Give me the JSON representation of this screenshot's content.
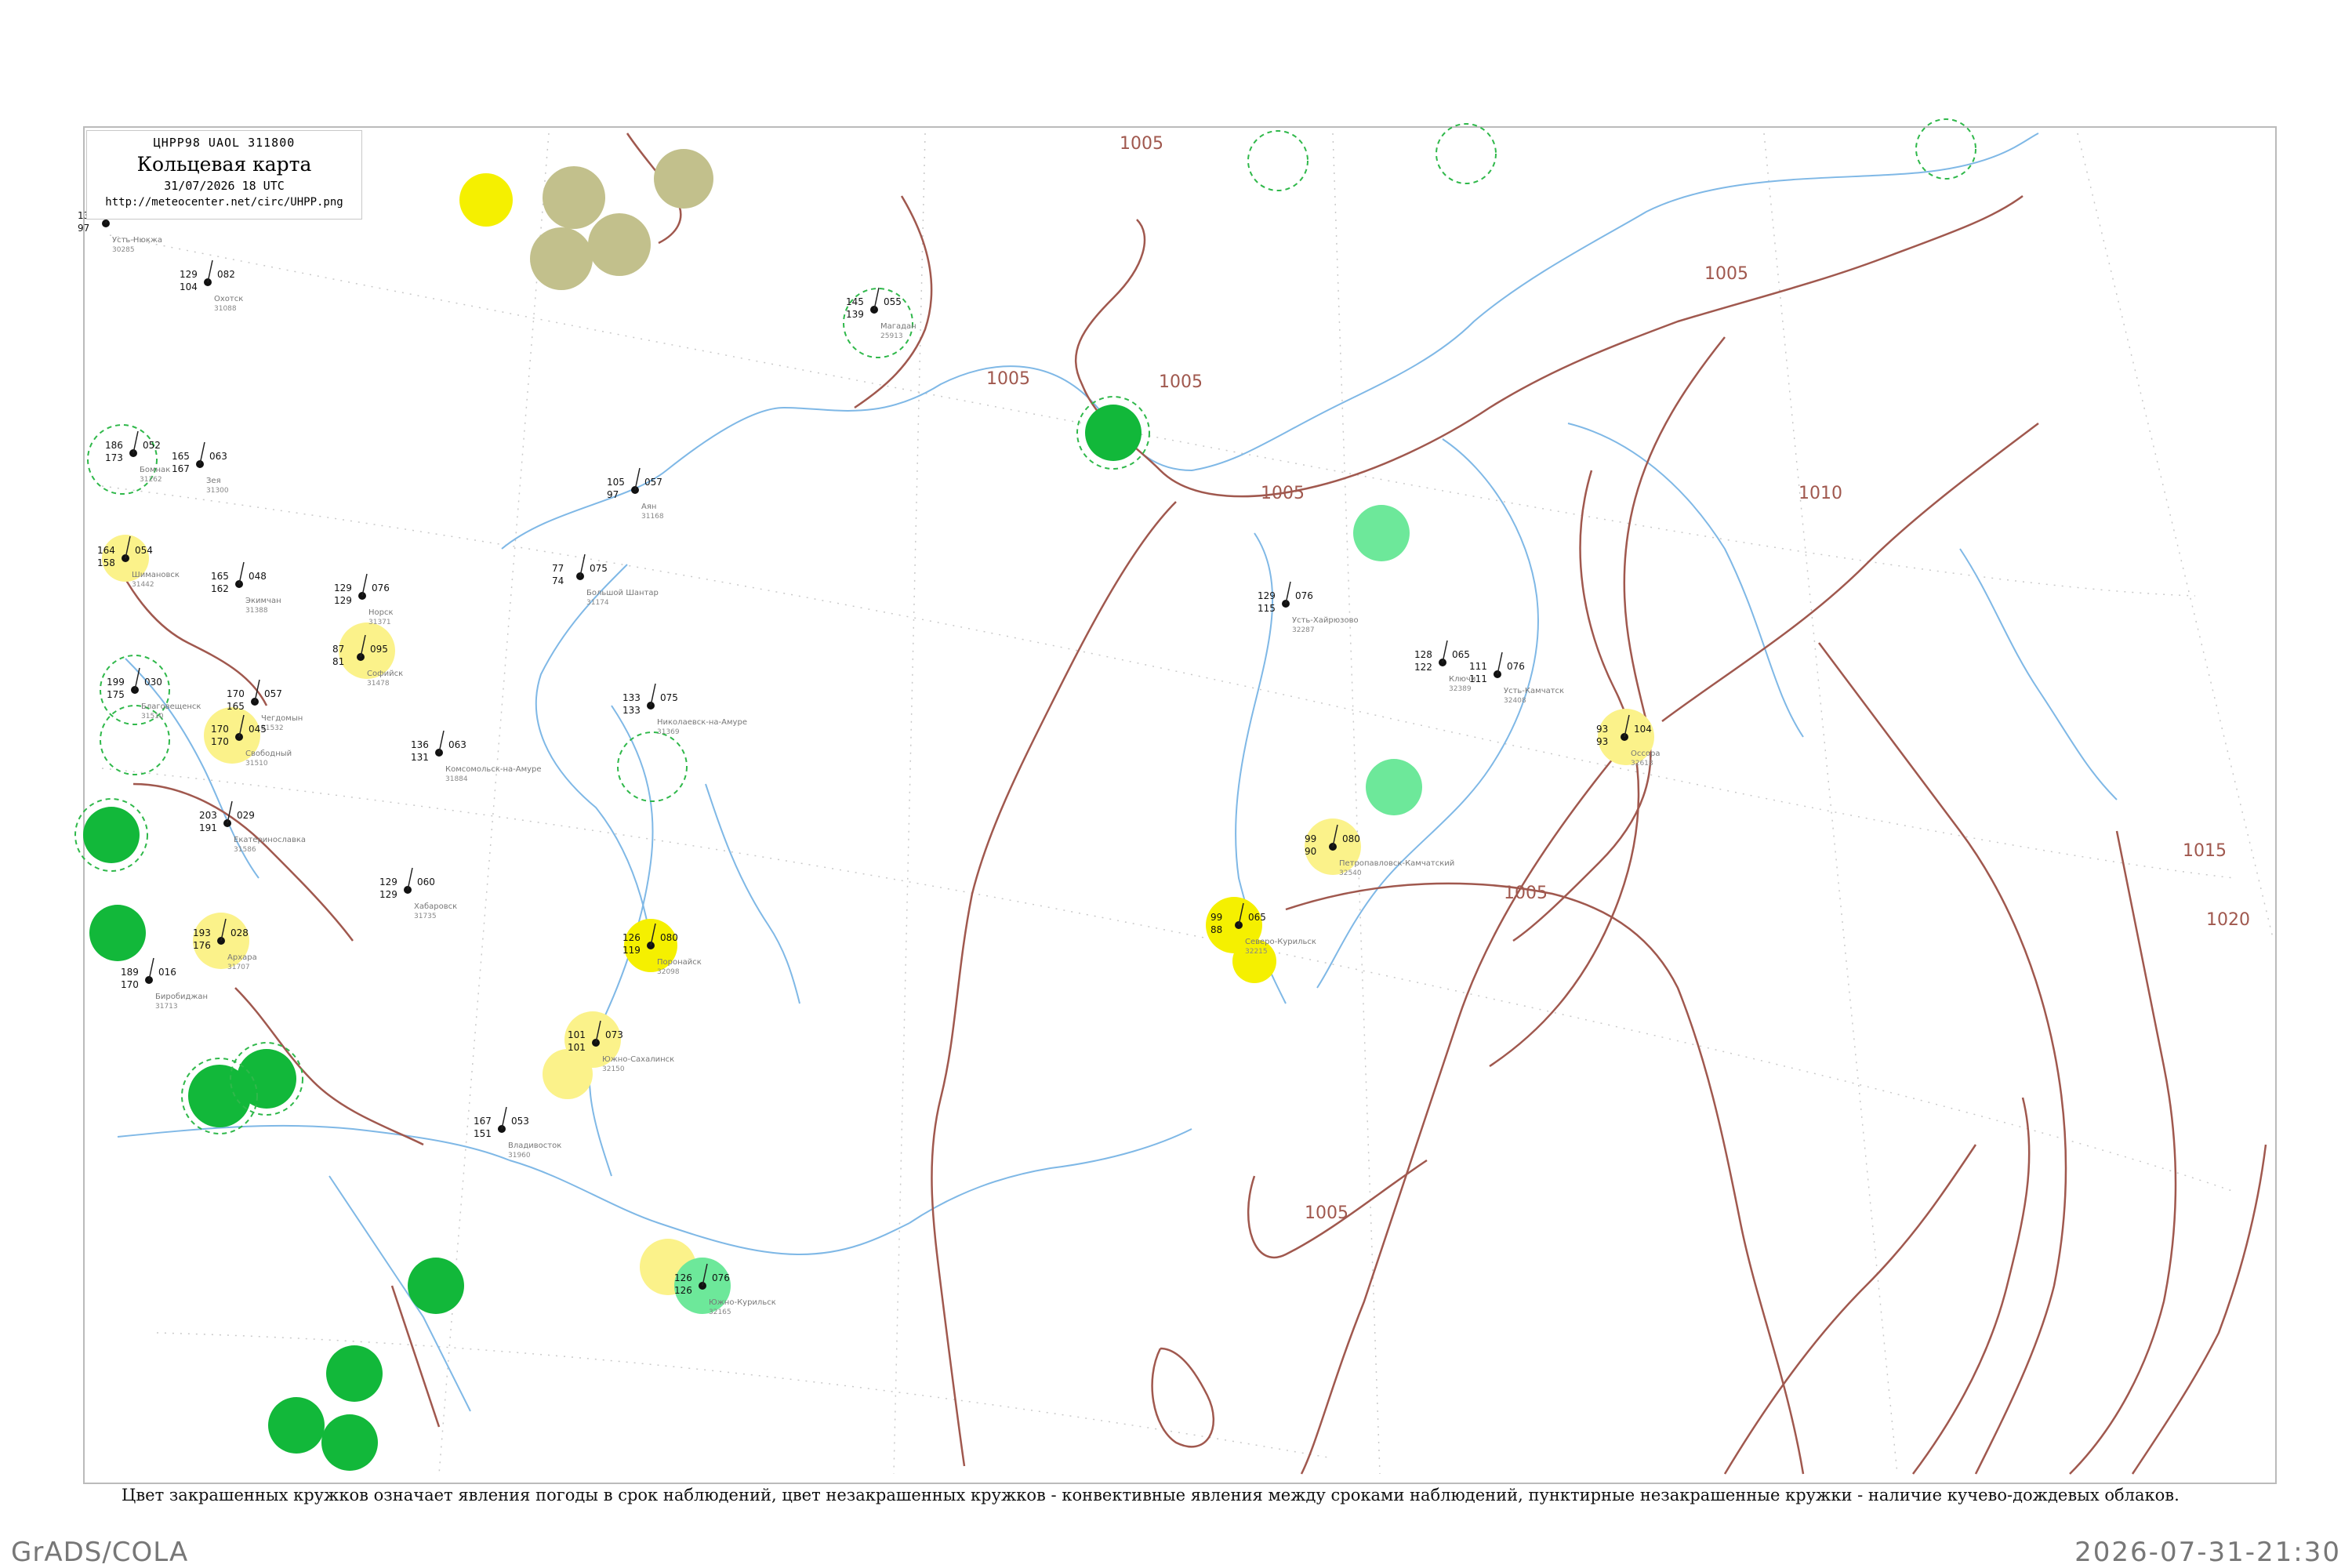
{
  "legend": {
    "code": "ЦHPP98  UAOL  311800",
    "title": "Кольцевая карта",
    "date": "31/07/2026 18 UTC",
    "url": "http://meteocenter.net/circ/UHPP.png"
  },
  "caption": "Цвет закрашенных кружков означает явления погоды в срок наблюдений, цвет незакрашенных кружков - конвективные явления между сроками наблюдений, пунктирные незакрашенные кружки - наличие кучево-дождевых облаков.",
  "footer": {
    "software": "GrADS/COLA",
    "timestamp": "2026-07-31-21:30"
  },
  "colors": {
    "isobar": "#a0584e",
    "coast": "#7fb8e6",
    "dark_green": "#12b83a",
    "green": "#6de89a",
    "yellow": "#f5f000",
    "light_yellow": "#fbf28a",
    "olive": "#c2c08c",
    "dashed_green": "#2fb84a"
  },
  "isobar_labels": [
    "1005",
    "1005",
    "1005",
    "1005",
    "1005",
    "1005",
    "1005",
    "1010",
    "1015",
    "1020"
  ],
  "stations": [
    {
      "name": "Усть-Нюкжа",
      "id": "30285",
      "p": "121",
      "t": "132",
      "td": "97"
    },
    {
      "name": "Зея",
      "id": "31300",
      "p": "063",
      "t": "165",
      "td": "167"
    },
    {
      "name": "Шимановск",
      "id": "31442",
      "p": "054",
      "t": "164",
      "td": "158"
    },
    {
      "name": "Экимчан",
      "id": "31388",
      "p": "048",
      "t": "165",
      "td": "162"
    },
    {
      "name": "Бомнак",
      "id": "31262",
      "p": "052",
      "t": "186",
      "td": "173"
    },
    {
      "name": "Норск",
      "id": "31371",
      "p": "076",
      "t": "129",
      "td": "129"
    },
    {
      "name": "Софийск",
      "id": "31478",
      "p": "095",
      "t": "87",
      "td": "81"
    },
    {
      "name": "Чегдомын",
      "id": "31532",
      "p": "057",
      "t": "170",
      "td": "165"
    },
    {
      "name": "Свободный",
      "id": "31510",
      "p": "045",
      "t": "170",
      "td": "170"
    },
    {
      "name": "Благовещенск",
      "id": "31510",
      "p": "030",
      "t": "199",
      "td": "175"
    },
    {
      "name": "Екатеринославка",
      "id": "31586",
      "p": "029",
      "t": "203",
      "td": "191"
    },
    {
      "name": "Архара",
      "id": "31707",
      "p": "028",
      "t": "193",
      "td": "176"
    },
    {
      "name": "Биробиджан",
      "id": "31713",
      "p": "016",
      "t": "189",
      "td": "170"
    },
    {
      "name": "Хабаровск",
      "id": "31735",
      "p": "060",
      "t": "129",
      "td": "129"
    },
    {
      "name": "Комсомольск-на-Амуре",
      "id": "31884",
      "p": "063",
      "t": "136",
      "td": "131"
    },
    {
      "name": "Николаевск-на-Амуре",
      "id": "31369",
      "p": "075",
      "t": "133",
      "td": "133"
    },
    {
      "name": "Охотск",
      "id": "31088",
      "p": "082",
      "t": "129",
      "td": "104"
    },
    {
      "name": "Аян",
      "id": "31168",
      "p": "057",
      "t": "105",
      "td": "97"
    },
    {
      "name": "Большой Шантар",
      "id": "31174",
      "p": "075",
      "t": "77",
      "td": "74"
    },
    {
      "name": "Магадан",
      "id": "25913",
      "p": "055",
      "t": "145",
      "td": "139"
    },
    {
      "name": "Северо-Курильск",
      "id": "32215",
      "p": "065",
      "t": "99",
      "td": "88"
    },
    {
      "name": "Южно-Курильск",
      "id": "32165",
      "p": "076",
      "t": "126",
      "td": "126"
    },
    {
      "name": "Усть-Камчатск",
      "id": "32408",
      "p": "076",
      "t": "111",
      "td": "111"
    },
    {
      "name": "Петропавловск-Камчатский",
      "id": "32540",
      "p": "080",
      "t": "99",
      "td": "90"
    },
    {
      "name": "Ключи",
      "id": "32389",
      "p": "065",
      "t": "128",
      "td": "122"
    },
    {
      "name": "Усть-Хайрюзово",
      "id": "32287",
      "p": "076",
      "t": "129",
      "td": "115"
    },
    {
      "name": "Оссора",
      "id": "32618",
      "p": "104",
      "t": "93",
      "td": "93"
    },
    {
      "name": "Южно-Сахалинск",
      "id": "32150",
      "p": "073",
      "t": "101",
      "td": "101"
    },
    {
      "name": "Поронайск",
      "id": "32098",
      "p": "080",
      "t": "126",
      "td": "119"
    },
    {
      "name": "Владивосток",
      "id": "31960",
      "p": "053",
      "t": "167",
      "td": "151"
    }
  ]
}
